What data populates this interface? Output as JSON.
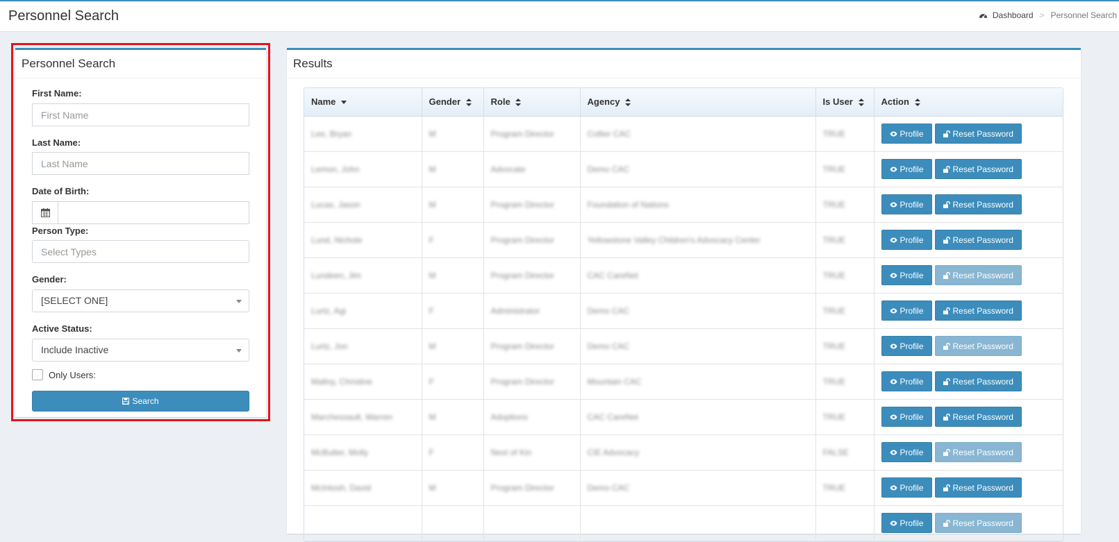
{
  "header": {
    "title": "Personnel Search",
    "breadcrumb": {
      "home": "Dashboard",
      "separator": ">",
      "current": "Personnel Search"
    }
  },
  "search_panel": {
    "title": "Personnel Search",
    "first_name": {
      "label": "First Name:",
      "placeholder": "First Name",
      "value": ""
    },
    "last_name": {
      "label": "Last Name:",
      "placeholder": "Last Name",
      "value": ""
    },
    "dob": {
      "label": "Date of Birth:",
      "value": "",
      "icon": "calendar-icon"
    },
    "person_type": {
      "label": "Person Type:",
      "placeholder": "Select Types"
    },
    "gender": {
      "label": "Gender:",
      "selected": "[SELECT ONE]"
    },
    "active_status": {
      "label": "Active Status:",
      "selected": "Include Inactive"
    },
    "only_users": {
      "label": "Only Users:",
      "checked": false
    },
    "search_button": "Search"
  },
  "results": {
    "title": "Results",
    "columns": [
      "Name",
      "Gender",
      "Role",
      "Agency",
      "Is User",
      "Action"
    ],
    "profile_label": "Profile",
    "reset_label": "Reset Password",
    "rows": [
      {
        "name": "Lee, Bryan",
        "gender": "M",
        "role": "Program Director",
        "agency": "Collier CAC",
        "is_user": "TRUE",
        "reset_enabled": true
      },
      {
        "name": "Lemon, John",
        "gender": "M",
        "role": "Advocate",
        "agency": "Demo CAC",
        "is_user": "TRUE",
        "reset_enabled": true
      },
      {
        "name": "Lucas, Jason",
        "gender": "M",
        "role": "Program Director",
        "agency": "Foundation of Nations",
        "is_user": "TRUE",
        "reset_enabled": true
      },
      {
        "name": "Lund, Nichole",
        "gender": "F",
        "role": "Program Director",
        "agency": "Yellowstone Valley Children's Advocacy Center",
        "is_user": "TRUE",
        "reset_enabled": true
      },
      {
        "name": "Lundeen, Jim",
        "gender": "M",
        "role": "Program Director",
        "agency": "CAC CareNet",
        "is_user": "TRUE",
        "reset_enabled": false
      },
      {
        "name": "Lurtz, Agi",
        "gender": "F",
        "role": "Administrator",
        "agency": "Demo CAC",
        "is_user": "TRUE",
        "reset_enabled": true
      },
      {
        "name": "Lurtz, Jon",
        "gender": "M",
        "role": "Program Director",
        "agency": "Demo CAC",
        "is_user": "TRUE",
        "reset_enabled": false
      },
      {
        "name": "Malloy, Christine",
        "gender": "F",
        "role": "Program Director",
        "agency": "Mountain CAC",
        "is_user": "TRUE",
        "reset_enabled": true
      },
      {
        "name": "Marchessault, Warren",
        "gender": "M",
        "role": "Adoptions",
        "agency": "CAC CareNet",
        "is_user": "TRUE",
        "reset_enabled": true
      },
      {
        "name": "McButter, Molly",
        "gender": "F",
        "role": "Next of Kin",
        "agency": "CIE Advocacy",
        "is_user": "FALSE",
        "reset_enabled": false
      },
      {
        "name": "McIntosh, David",
        "gender": "M",
        "role": "Program Director",
        "agency": "Demo CAC",
        "is_user": "TRUE",
        "reset_enabled": true
      },
      {
        "name": "",
        "gender": "",
        "role": "",
        "agency": "",
        "is_user": "",
        "reset_enabled": false
      }
    ]
  },
  "colors": {
    "primary": "#3c8dbc",
    "highlight": "#e3141b",
    "background": "#ecf0f5"
  }
}
